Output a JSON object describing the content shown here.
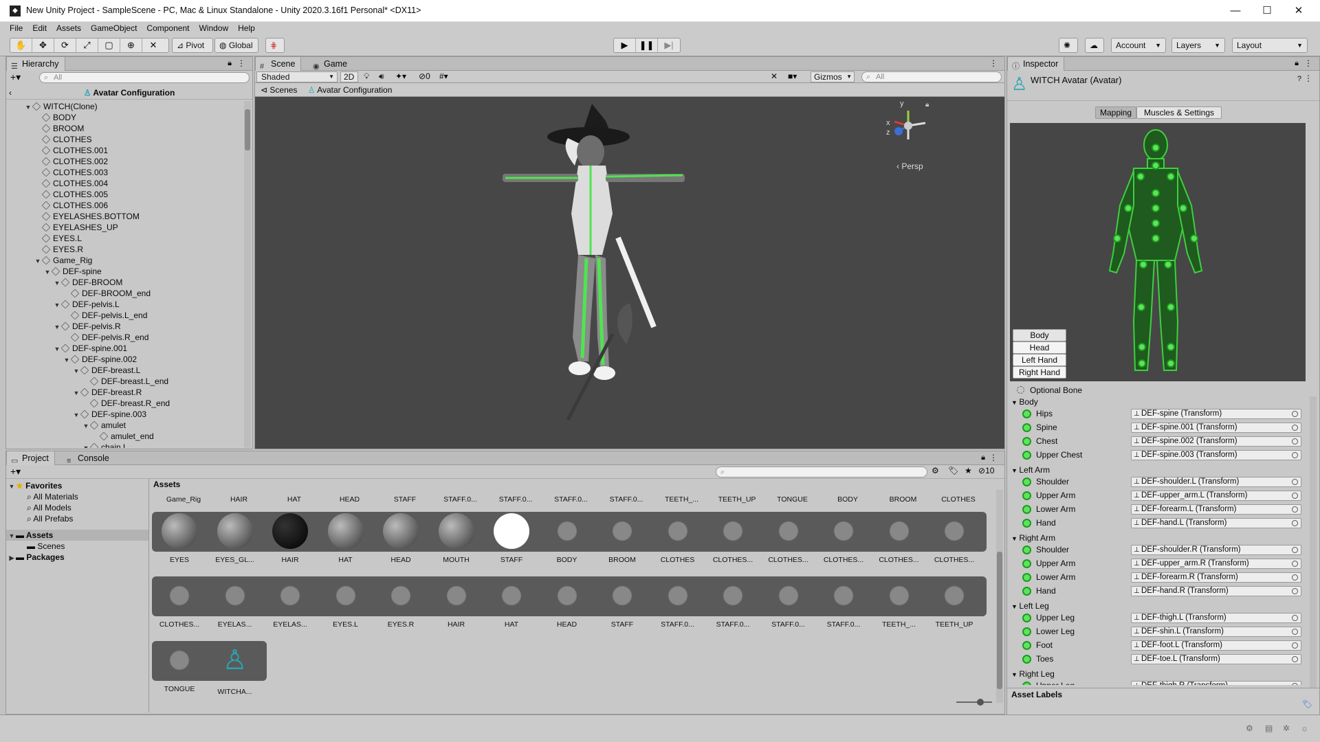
{
  "window": {
    "title": "New Unity Project - SampleScene - PC, Mac & Linux Standalone - Unity 2020.3.16f1 Personal* <DX11>"
  },
  "menu": [
    "File",
    "Edit",
    "Assets",
    "GameObject",
    "Component",
    "Window",
    "Help"
  ],
  "toolbar": {
    "pivot": "Pivot",
    "global": "Global",
    "account": "Account",
    "layers": "Layers",
    "layout": "Layout"
  },
  "hierarchy": {
    "tab": "Hierarchy",
    "search_placeholder": "All",
    "header": "Avatar Configuration",
    "rows": [
      {
        "label": "WITCH(Clone)",
        "indent": 0,
        "arrow": "▼"
      },
      {
        "label": "BODY",
        "indent": 1,
        "arrow": ""
      },
      {
        "label": "BROOM",
        "indent": 1,
        "arrow": ""
      },
      {
        "label": "CLOTHES",
        "indent": 1,
        "arrow": ""
      },
      {
        "label": "CLOTHES.001",
        "indent": 1,
        "arrow": ""
      },
      {
        "label": "CLOTHES.002",
        "indent": 1,
        "arrow": ""
      },
      {
        "label": "CLOTHES.003",
        "indent": 1,
        "arrow": ""
      },
      {
        "label": "CLOTHES.004",
        "indent": 1,
        "arrow": ""
      },
      {
        "label": "CLOTHES.005",
        "indent": 1,
        "arrow": ""
      },
      {
        "label": "CLOTHES.006",
        "indent": 1,
        "arrow": ""
      },
      {
        "label": "EYELASHES.BOTTOM",
        "indent": 1,
        "arrow": ""
      },
      {
        "label": "EYELASHES_UP",
        "indent": 1,
        "arrow": ""
      },
      {
        "label": "EYES.L",
        "indent": 1,
        "arrow": ""
      },
      {
        "label": "EYES.R",
        "indent": 1,
        "arrow": ""
      },
      {
        "label": "Game_Rig",
        "indent": 1,
        "arrow": "▼"
      },
      {
        "label": "DEF-spine",
        "indent": 2,
        "arrow": "▼"
      },
      {
        "label": "DEF-BROOM",
        "indent": 3,
        "arrow": "▼"
      },
      {
        "label": "DEF-BROOM_end",
        "indent": 4,
        "arrow": ""
      },
      {
        "label": "DEF-pelvis.L",
        "indent": 3,
        "arrow": "▼"
      },
      {
        "label": "DEF-pelvis.L_end",
        "indent": 4,
        "arrow": ""
      },
      {
        "label": "DEF-pelvis.R",
        "indent": 3,
        "arrow": "▼"
      },
      {
        "label": "DEF-pelvis.R_end",
        "indent": 4,
        "arrow": ""
      },
      {
        "label": "DEF-spine.001",
        "indent": 3,
        "arrow": "▼"
      },
      {
        "label": "DEF-spine.002",
        "indent": 4,
        "arrow": "▼"
      },
      {
        "label": "DEF-breast.L",
        "indent": 5,
        "arrow": "▼"
      },
      {
        "label": "DEF-breast.L_end",
        "indent": 6,
        "arrow": ""
      },
      {
        "label": "DEF-breast.R",
        "indent": 5,
        "arrow": "▼"
      },
      {
        "label": "DEF-breast.R_end",
        "indent": 6,
        "arrow": ""
      },
      {
        "label": "DEF-spine.003",
        "indent": 5,
        "arrow": "▼"
      },
      {
        "label": "amulet",
        "indent": 6,
        "arrow": "▼"
      },
      {
        "label": "amulet_end",
        "indent": 7,
        "arrow": ""
      },
      {
        "label": "chain.L",
        "indent": 6,
        "arrow": "▼"
      }
    ]
  },
  "scene": {
    "tab_scene": "Scene",
    "tab_game": "Game",
    "shading": "Shaded",
    "mode_2d": "2D",
    "hidden_count": "0",
    "gizmos": "Gizmos",
    "search_placeholder": "All",
    "breadcrumb_scenes": "Scenes",
    "breadcrumb_config": "Avatar Configuration",
    "persp": "Persp",
    "axes": {
      "x": "x",
      "y": "y",
      "z": "z"
    }
  },
  "project": {
    "tab_project": "Project",
    "tab_console": "Console",
    "hidden_count": "10",
    "favorites": {
      "label": "Favorites",
      "items": [
        "All Materials",
        "All Models",
        "All Prefabs"
      ]
    },
    "assets_folder": "Assets",
    "scenes_folder": "Scenes",
    "packages": "Packages",
    "breadcrumb": "Assets",
    "row0": [
      "Game_Rig",
      "HAIR",
      "HAT",
      "HEAD",
      "STAFF",
      "STAFF.0...",
      "STAFF.0...",
      "STAFF.0...",
      "STAFF.0...",
      "TEETH_...",
      "TEETH_UP",
      "TONGUE",
      "BODY",
      "BROOM",
      "CLOTHES"
    ],
    "row1": [
      "EYES",
      "EYES_GL...",
      "HAIR",
      "HAT",
      "HEAD",
      "MOUTH",
      "STAFF",
      "BODY",
      "BROOM",
      "CLOTHES",
      "CLOTHES...",
      "CLOTHES...",
      "CLOTHES...",
      "CLOTHES...",
      "CLOTHES..."
    ],
    "row2": [
      "CLOTHES...",
      "EYELAS...",
      "EYELAS...",
      "EYES.L",
      "EYES.R",
      "HAIR",
      "HAT",
      "HEAD",
      "STAFF",
      "STAFF.0...",
      "STAFF.0...",
      "STAFF.0...",
      "STAFF.0...",
      "TEETH_...",
      "TEETH_UP"
    ],
    "row3": [
      "TONGUE",
      "WITCHA..."
    ]
  },
  "inspector": {
    "tab": "Inspector",
    "title": "WITCH Avatar (Avatar)",
    "tab_mapping": "Mapping",
    "tab_muscles": "Muscles & Settings",
    "body_buttons": [
      "Body",
      "Head",
      "Left Hand",
      "Right Hand"
    ],
    "optional_bone": "Optional Bone",
    "sections": [
      {
        "name": "Body",
        "bones": [
          {
            "label": "Hips",
            "value": "DEF-spine (Transform)"
          },
          {
            "label": "Spine",
            "value": "DEF-spine.001 (Transform)"
          },
          {
            "label": "Chest",
            "value": "DEF-spine.002 (Transform)"
          },
          {
            "label": "Upper Chest",
            "value": "DEF-spine.003 (Transform)"
          }
        ]
      },
      {
        "name": "Left Arm",
        "bones": [
          {
            "label": "Shoulder",
            "value": "DEF-shoulder.L (Transform)"
          },
          {
            "label": "Upper Arm",
            "value": "DEF-upper_arm.L (Transform)"
          },
          {
            "label": "Lower Arm",
            "value": "DEF-forearm.L (Transform)"
          },
          {
            "label": "Hand",
            "value": "DEF-hand.L (Transform)"
          }
        ]
      },
      {
        "name": "Right Arm",
        "bones": [
          {
            "label": "Shoulder",
            "value": "DEF-shoulder.R (Transform)"
          },
          {
            "label": "Upper Arm",
            "value": "DEF-upper_arm.R (Transform)"
          },
          {
            "label": "Lower Arm",
            "value": "DEF-forearm.R (Transform)"
          },
          {
            "label": "Hand",
            "value": "DEF-hand.R (Transform)"
          }
        ]
      },
      {
        "name": "Left Leg",
        "bones": [
          {
            "label": "Upper Leg",
            "value": "DEF-thigh.L (Transform)"
          },
          {
            "label": "Lower Leg",
            "value": "DEF-shin.L (Transform)"
          },
          {
            "label": "Foot",
            "value": "DEF-foot.L (Transform)"
          },
          {
            "label": "Toes",
            "value": "DEF-toe.L (Transform)"
          }
        ]
      },
      {
        "name": "Right Leg",
        "bones": [
          {
            "label": "Upper Leg",
            "value": "DEF-thigh.R (Transform)"
          }
        ]
      }
    ],
    "asset_labels": "Asset Labels"
  },
  "colors": {
    "bone_green": "#5ee35e",
    "accent_teal": "#2aa3b3"
  }
}
